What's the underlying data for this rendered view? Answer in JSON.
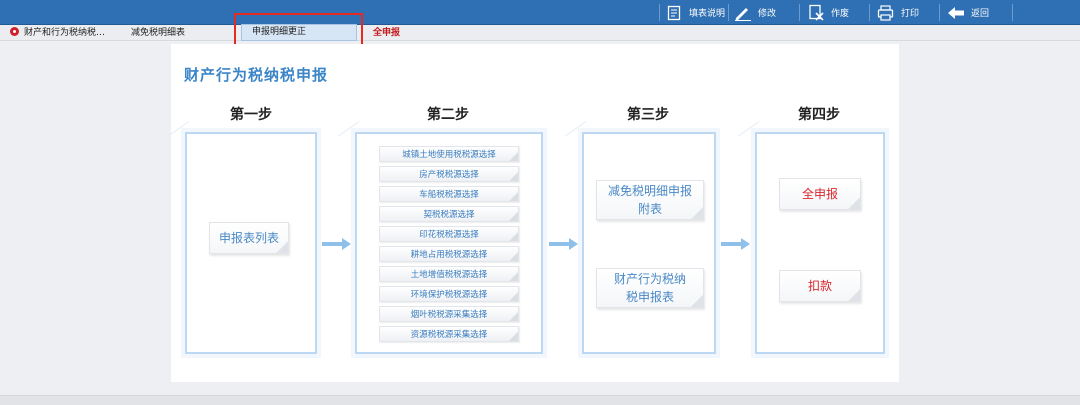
{
  "toolbar": {
    "buttons": [
      {
        "label": "填表说明",
        "icon": "document-icon"
      },
      {
        "label": "修改",
        "icon": "pencil-icon"
      },
      {
        "label": "作废",
        "icon": "void-doc-icon"
      },
      {
        "label": "打印",
        "icon": "printer-icon"
      },
      {
        "label": "返回",
        "icon": "back-arrow-icon"
      }
    ]
  },
  "tabs": [
    {
      "label": "财产和行为税纳税…",
      "icon": "gear-icon"
    },
    {
      "label": "减免税明细表"
    },
    {
      "label": "申报明细更正",
      "active": true
    },
    {
      "label": "全申报",
      "color": "#c21a1a"
    }
  ],
  "page": {
    "title": "财产行为税纳税申报",
    "steps": [
      "第一步",
      "第二步",
      "第三步",
      "第四步"
    ],
    "step1": {
      "card": "申报表列表"
    },
    "step2": {
      "sources": [
        "城镇土地使用税税源选择",
        "房产税税源选择",
        "车船税税源选择",
        "契税税源选择",
        "印花税税源选择",
        "耕地占用税税源选择",
        "土地增值税税源选择",
        "环境保护税税源选择",
        "烟叶税税源采集选择",
        "资源税税源采集选择"
      ]
    },
    "step3": {
      "cards": [
        "减免税明细申报附表",
        "财产行为税纳税申报表"
      ]
    },
    "step4": {
      "cards": [
        "全申报",
        "扣款"
      ]
    }
  },
  "colors": {
    "toolbar": "#2f6fb3",
    "accent_blue": "#3c86c8",
    "red": "#d9262c",
    "highlight_box": "#e52a23"
  }
}
